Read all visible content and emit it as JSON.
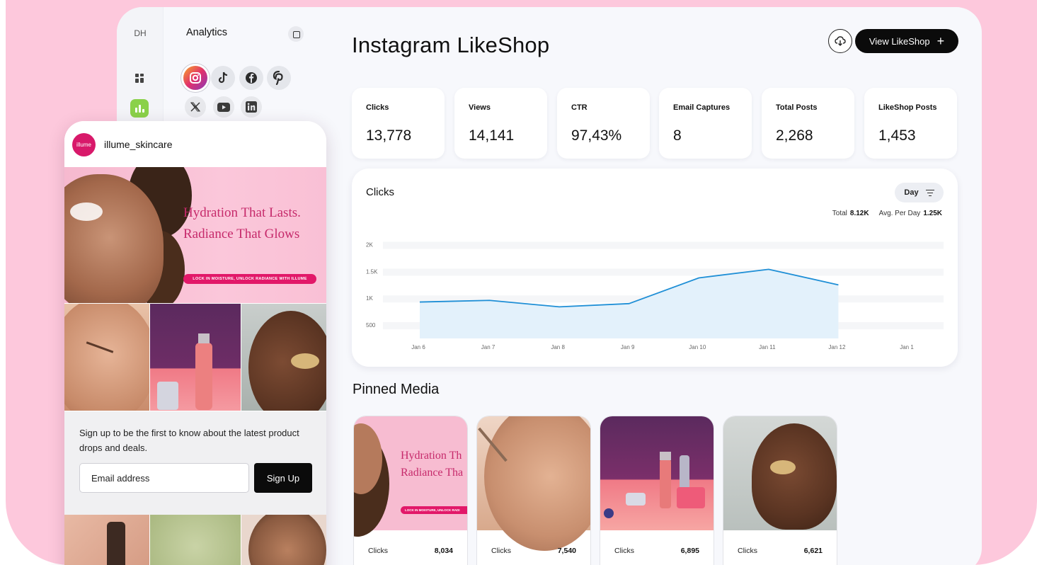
{
  "sidebar": {
    "initials": "DH",
    "title": "Analytics",
    "networks": [
      "instagram",
      "tiktok",
      "facebook",
      "pinterest",
      "x",
      "youtube",
      "linkedin"
    ]
  },
  "header": {
    "title": "Instagram LikeShop",
    "view_button": "View LikeShop",
    "view_button_icon": "+"
  },
  "stats": [
    {
      "label": "Clicks",
      "value": "13,778"
    },
    {
      "label": "Views",
      "value": "14,141"
    },
    {
      "label": "CTR",
      "value": "97,43%"
    },
    {
      "label": "Email Captures",
      "value": "8"
    },
    {
      "label": "Total Posts",
      "value": "2,268"
    },
    {
      "label": "LikeShop Posts",
      "value": "1,453"
    }
  ],
  "clicks_chart": {
    "title": "Clicks",
    "filter": "Day",
    "total_label": "Total",
    "total_value": "8.12K",
    "avg_label": "Avg. Per Day",
    "avg_value": "1.25K"
  },
  "chart_data": {
    "type": "area",
    "title": "Clicks",
    "x": [
      "Jan 6",
      "Jan 7",
      "Jan 8",
      "Jan 9",
      "Jan 10",
      "Jan 11",
      "Jan 12",
      "Jan 1"
    ],
    "values": [
      930,
      960,
      840,
      900,
      1380,
      1540,
      1250
    ],
    "yticks": [
      "2K",
      "1.5K",
      "1K",
      "500"
    ],
    "ytick_values": [
      2000,
      1500,
      1000,
      500
    ],
    "ylim": [
      250,
      2100
    ],
    "color": "#1f8fd6",
    "fill": "#e3f1fb"
  },
  "pinned": {
    "title": "Pinned Media",
    "items": [
      {
        "label": "Clicks",
        "value": "8,034"
      },
      {
        "label": "Clicks",
        "value": "7,540"
      },
      {
        "label": "Clicks",
        "value": "6,895"
      },
      {
        "label": "Clicks",
        "value": "6,621"
      }
    ],
    "hero_text_lines": [
      "Hydration Th",
      "Radiance Tha"
    ],
    "hero_pill": "LOCK IN MOISTURE, UNLOCK RADI"
  },
  "phone": {
    "avatar_text": "illume",
    "username": "illume_skincare",
    "hero_line1": "Hydration That Lasts.",
    "hero_line2": "Radiance That Glows",
    "hero_pill": "LOCK IN MOISTURE, UNLOCK RADIANCE WITH ILLUME",
    "signup_message": "Sign up to be the first to know about the latest product drops and deals.",
    "email_placeholder": "Email address",
    "signup_button": "Sign Up"
  },
  "colors": {
    "background_pink": "#fdc8dc",
    "brand_pink": "#e21869",
    "accent_green": "#8ad14a",
    "line_blue": "#1f8fd6"
  }
}
